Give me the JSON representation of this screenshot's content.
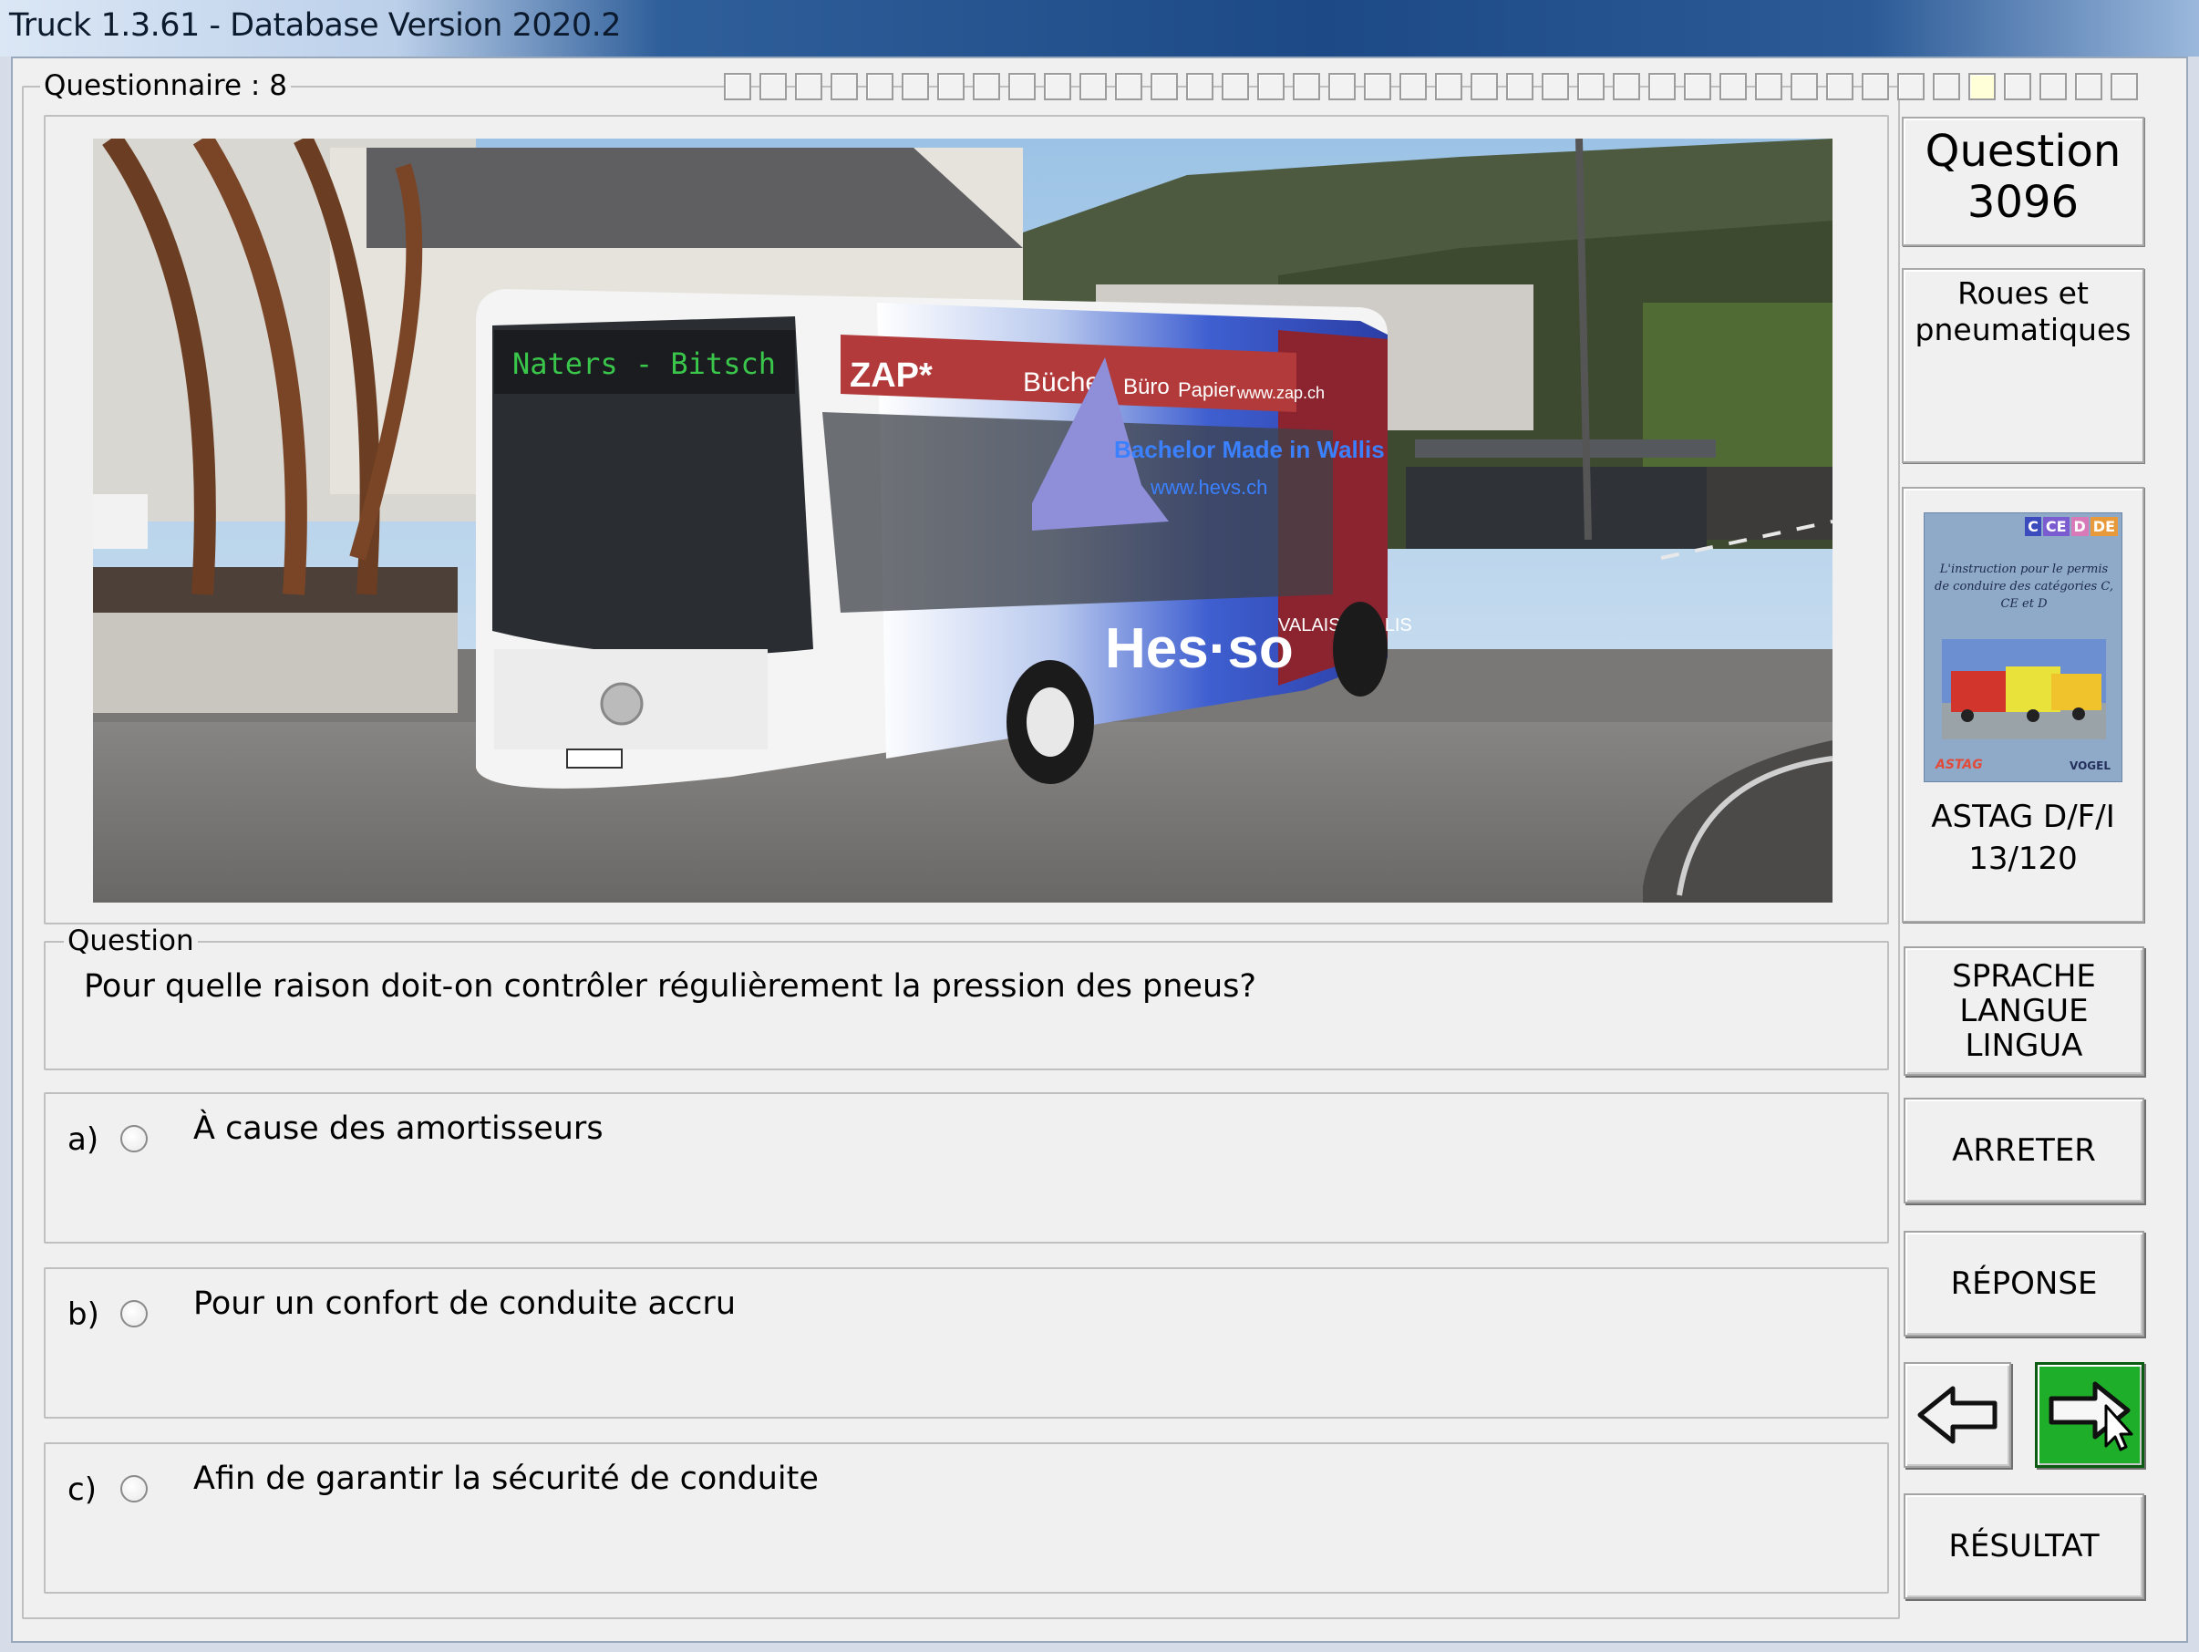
{
  "window": {
    "title": "Truck 1.3.61 - Database Version 2020.2"
  },
  "questionnaire": {
    "label": "Questionnaire : 8",
    "progress_total": 40,
    "progress_active_index": 35
  },
  "question_panel": {
    "number_label": "Question",
    "number": "3096",
    "category": "Roues et pneumatiques",
    "book": {
      "badges": [
        "C",
        "CE",
        "D",
        "DE"
      ],
      "cover_text": "L'instruction pour le permis de conduire des catégories C, CE et D",
      "publisher_left": "ASTAG",
      "publisher_right": "VOGEL",
      "reference_line1": "ASTAG D/F/I",
      "reference_line2": "13/120"
    }
  },
  "question": {
    "group_label": "Question",
    "text": "Pour quelle raison doit-on contrôler régulièrement la pression des pneus?"
  },
  "answers": [
    {
      "letter": "a)",
      "text": "À cause des amortisseurs"
    },
    {
      "letter": "b)",
      "text": "Pour un confort de conduite accru"
    },
    {
      "letter": "c)",
      "text": "Afin de garantir la sécurité de conduite"
    }
  ],
  "buttons": {
    "language_line1": "SPRACHE",
    "language_line2": "LANGUE",
    "language_line3": "LINGUA",
    "stop": "ARRETER",
    "answer": "RÉPONSE",
    "result": "RÉSULTAT"
  },
  "photo": {
    "bus_destination": "Naters - Bitsch",
    "ad_zap": "ZAP*",
    "ad_buecher": "Bücher",
    "ad_buero": "Büro",
    "ad_papier": "Papier",
    "ad_url": "www.zap.ch",
    "ad_bachelor": "Bachelor Made in Wallis",
    "ad_hes_url": "www.hevs.ch",
    "ad_hesso": "Hes·so",
    "ad_valais": "VALAIS WALLIS"
  },
  "colors": {
    "next_button": "#1fae2a",
    "titlebar": "#1d4a86",
    "book_bg": "#8fa9c8"
  }
}
